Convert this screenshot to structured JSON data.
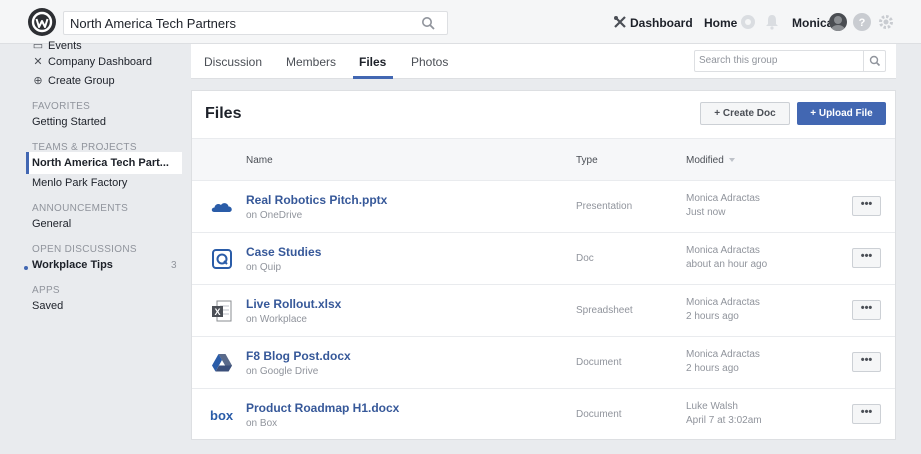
{
  "topbar": {
    "search_value": "North America Tech Partners",
    "dashboard_label": "Dashboard",
    "home_label": "Home",
    "user_name": "Monica"
  },
  "sidebar": {
    "top_items": [
      {
        "label": "Events",
        "icon": "calendar-icon"
      },
      {
        "label": "Company Dashboard",
        "icon": "tools-icon"
      },
      {
        "label": "Create Group",
        "icon": "plus-circle-icon"
      }
    ],
    "sections": [
      {
        "header": "FAVORITES",
        "items": [
          "Getting Started"
        ]
      },
      {
        "header": "TEAMS & PROJECTS",
        "items": [
          "North America Tech Part...",
          "Menlo Park Factory"
        ]
      },
      {
        "header": "ANNOUNCEMENTS",
        "items": [
          "General"
        ]
      },
      {
        "header": "OPEN DISCUSSIONS",
        "items": [
          "Workplace Tips"
        ],
        "count": "3"
      },
      {
        "header": "APPS",
        "items": [
          "Saved"
        ]
      }
    ]
  },
  "tabs": [
    {
      "label": "Discussion"
    },
    {
      "label": "Members"
    },
    {
      "label": "Files"
    },
    {
      "label": "Photos"
    }
  ],
  "active_tab": "Files",
  "group_search": {
    "placeholder": "Search this group"
  },
  "files": {
    "title": "Files",
    "create_doc_label": "+ Create Doc",
    "upload_label": "+ Upload File",
    "columns": {
      "name": "Name",
      "type": "Type",
      "modified": "Modified"
    },
    "rows": [
      {
        "name": "Real Robotics Pitch.pptx",
        "source": "on OneDrive",
        "type": "Presentation",
        "user": "Monica Adractas",
        "time": "Just now",
        "icon": "onedrive-icon",
        "more": "•••"
      },
      {
        "name": "Case Studies",
        "source": "on Quip",
        "type": "Doc",
        "user": "Monica Adractas",
        "time": "about an hour ago",
        "icon": "quip-icon",
        "more": "•••"
      },
      {
        "name": "Live Rollout.xlsx",
        "source": "on Workplace",
        "type": "Spreadsheet",
        "user": "Monica Adractas",
        "time": "2 hours ago",
        "icon": "excel-icon",
        "more": "•••"
      },
      {
        "name": "F8 Blog Post.docx",
        "source": "on Google Drive",
        "type": "Document",
        "user": "Monica Adractas",
        "time": "2 hours ago",
        "icon": "google-drive-icon",
        "more": "•••"
      },
      {
        "name": "Product Roadmap H1.docx",
        "source": "on Box",
        "type": "Document",
        "user": "Luke Walsh",
        "time": "April 7 at 3:02am",
        "icon": "box-icon",
        "more": "•••"
      }
    ]
  },
  "colors": {
    "accent": "#4267b2",
    "link": "#365899"
  }
}
